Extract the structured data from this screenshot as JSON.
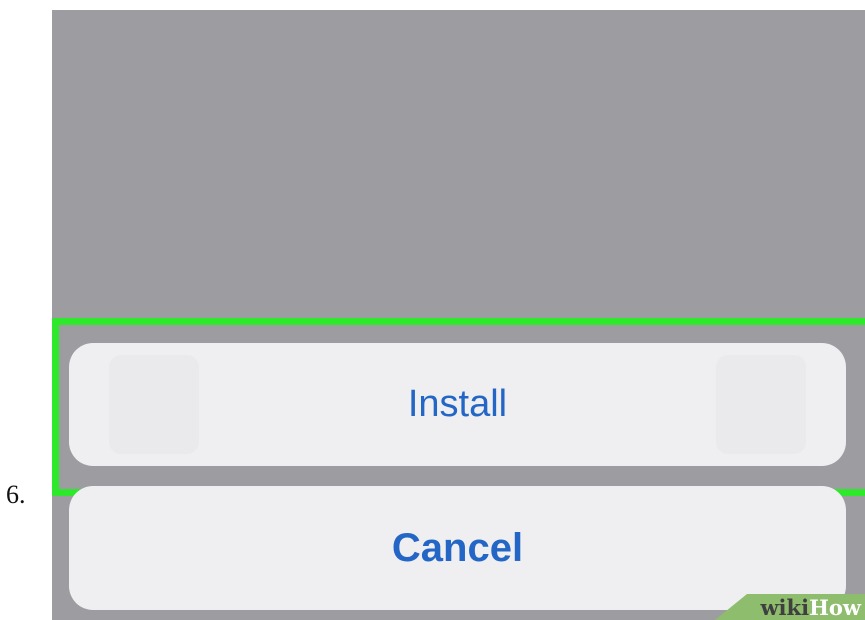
{
  "step_number": "6.",
  "sheet": {
    "install_label": "Install",
    "cancel_label": "Cancel"
  },
  "watermark": {
    "part1": "wiki",
    "part2": "How"
  },
  "colors": {
    "highlight": "#2ee82c",
    "button_text": "#2466c6",
    "button_bg": "#efeff1",
    "dim_background": "#9d9ca1"
  }
}
